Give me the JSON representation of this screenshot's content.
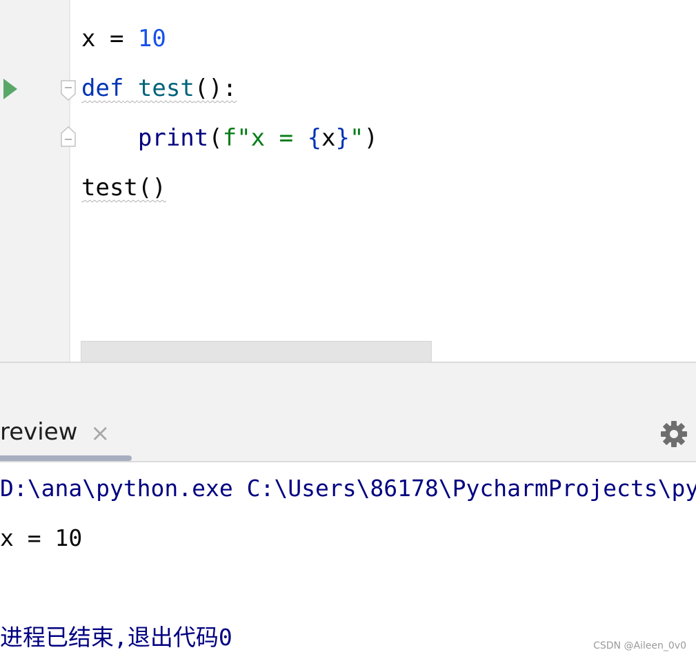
{
  "editor": {
    "line1": {
      "var": "x",
      "op": " = ",
      "num": "10"
    },
    "line2": {
      "kw": "def",
      "space": " ",
      "fn": "test",
      "rest": "():"
    },
    "line3": {
      "indent": "    ",
      "builtin": "print",
      "open": "(",
      "str_start": "f\"x = ",
      "brace_open": "{",
      "var": "x",
      "brace_close": "}",
      "str_end": "\"",
      "close": ")"
    },
    "line4": {
      "call": "test()"
    }
  },
  "tool_window": {
    "tab_label": "review",
    "close_glyph": "×"
  },
  "console": {
    "command": "D:\\ana\\python.exe C:\\Users\\86178\\PycharmProjects\\py",
    "output": "x = 10",
    "exit_message": "进程已结束,退出代码0"
  },
  "watermark": "CSDN @Aileen_0v0",
  "icons": [
    "run-icon",
    "fold-icon",
    "close-icon",
    "gear-icon"
  ],
  "colors": {
    "keyword": "#0033b3",
    "function": "#00627a",
    "number": "#1750eb",
    "string": "#067d17",
    "run": "#59a869"
  }
}
